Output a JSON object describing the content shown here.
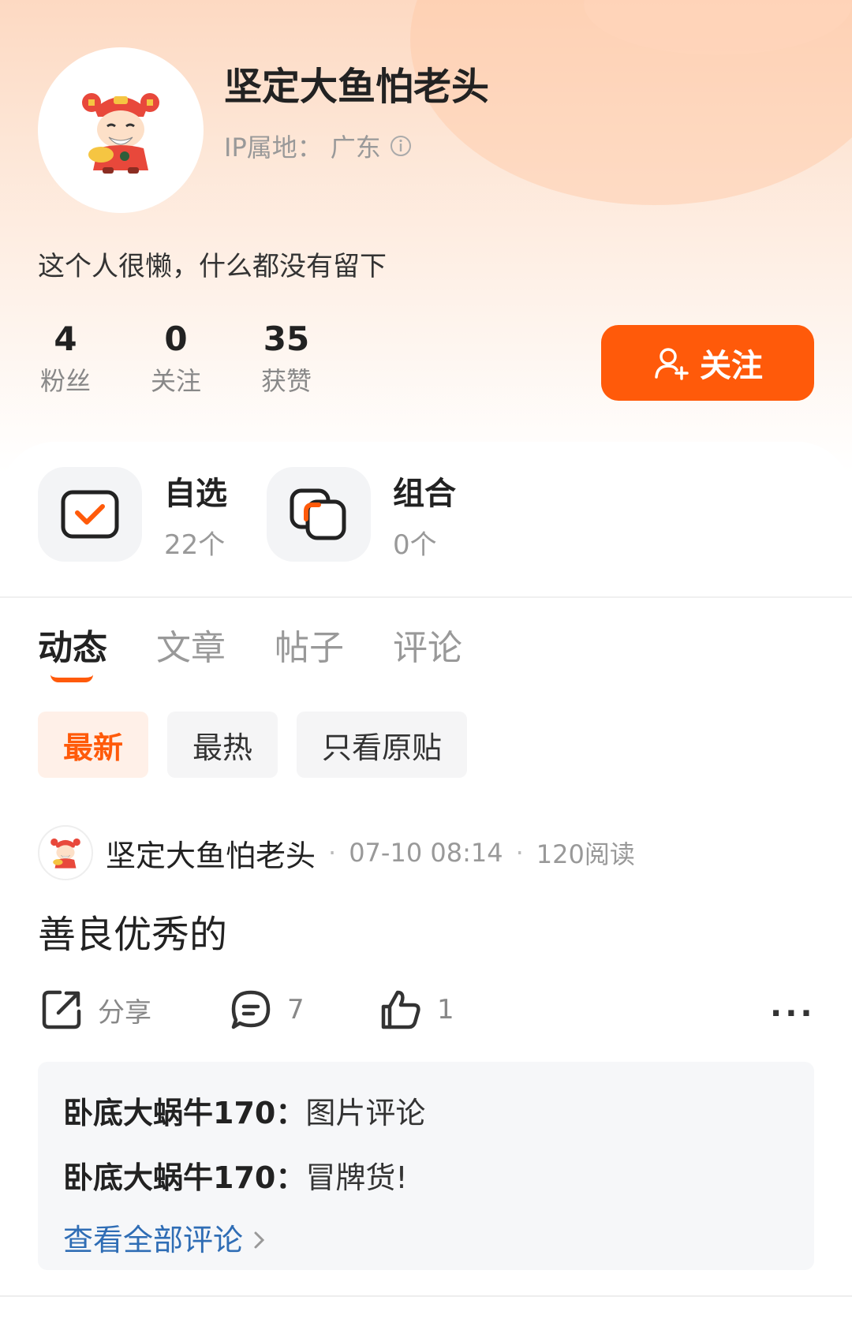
{
  "profile": {
    "name": "坚定大鱼怕老头",
    "ip_label": "IP属地：",
    "ip_value": "广东",
    "bio": "这个人很懒，什么都没有留下",
    "stats": [
      {
        "value": "4",
        "label": "粉丝"
      },
      {
        "value": "0",
        "label": "关注"
      },
      {
        "value": "35",
        "label": "获赞"
      }
    ],
    "follow_label": "关注"
  },
  "quick": [
    {
      "title": "自选",
      "sub": "22个",
      "icon": "checkbox-icon"
    },
    {
      "title": "组合",
      "sub": "0个",
      "icon": "portfolio-icon"
    }
  ],
  "tabs": [
    "动态",
    "文章",
    "帖子",
    "评论"
  ],
  "active_tab": 0,
  "filters": [
    "最新",
    "最热",
    "只看原贴"
  ],
  "active_filter": 0,
  "post": {
    "author": "坚定大鱼怕老头",
    "time": "07-10 08:14",
    "reads": "120阅读",
    "content": "善良优秀的",
    "share_label": "分享",
    "comment_count": "7",
    "like_count": "1",
    "comments": [
      {
        "user": "卧底大蜗牛170：",
        "text": "图片评论"
      },
      {
        "user": "卧底大蜗牛170：",
        "text": "冒牌货!"
      }
    ],
    "view_all": "查看全部评论"
  },
  "colors": {
    "accent": "#ff5a0a",
    "link": "#2f6db5"
  }
}
